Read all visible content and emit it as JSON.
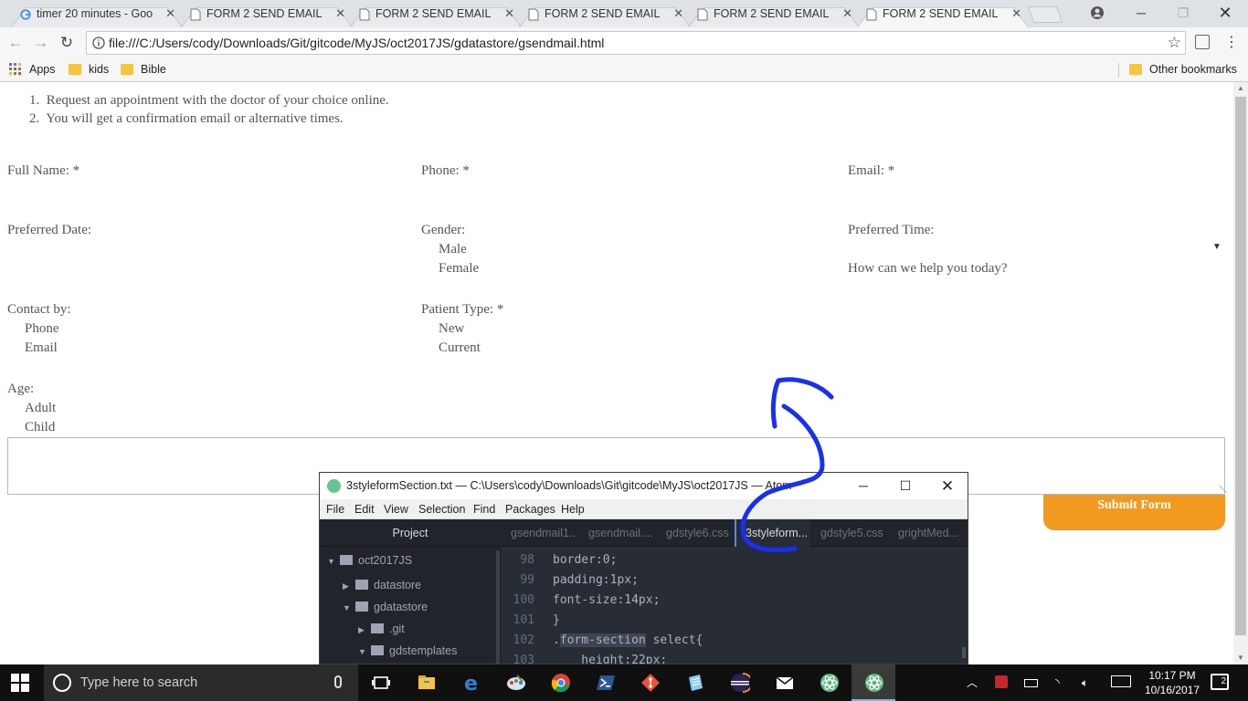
{
  "browser": {
    "tabs": [
      {
        "title": "timer 20 minutes - Goo",
        "icon": "google-icon",
        "active": false
      },
      {
        "title": "FORM 2 SEND EMAIL",
        "icon": "document-icon",
        "active": false
      },
      {
        "title": "FORM 2 SEND EMAIL",
        "icon": "document-icon",
        "active": false
      },
      {
        "title": "FORM 2 SEND EMAIL",
        "icon": "document-icon",
        "active": false
      },
      {
        "title": "FORM 2 SEND EMAIL",
        "icon": "document-icon",
        "active": false
      },
      {
        "title": "FORM 2 SEND EMAIL",
        "icon": "document-icon",
        "active": true
      }
    ],
    "url": "file:///C:/Users/cody/Downloads/Git/gitcode/MyJS/oct2017JS/gdatastore/gsendmail.html",
    "bookmarks": {
      "apps": "Apps",
      "items": [
        "kids",
        "Bible"
      ],
      "other": "Other bookmarks"
    }
  },
  "page": {
    "steps": [
      "1.  Request an appointment with the doctor of your choice online.",
      "2.  You will get a confirmation email or alternative times."
    ],
    "fields": {
      "full_name": "Full Name: *",
      "phone": "Phone: *",
      "email": "Email: *",
      "preferred_date": "Preferred Date:",
      "gender": "Gender:",
      "gender_options": [
        "Male",
        "Female"
      ],
      "preferred_time": "Preferred Time:",
      "help": "How can we help you today?",
      "contact_by": "Contact by:",
      "contact_options": [
        "Phone",
        "Email"
      ],
      "patient_type": "Patient Type: *",
      "patient_options": [
        "New",
        "Current"
      ],
      "age": "Age:",
      "age_options": [
        "Adult",
        "Child"
      ]
    },
    "submit_label": "Submit Form",
    "accent_color": "#f29a1f"
  },
  "atom": {
    "title": "3styleformSection.txt — C:\\Users\\cody\\Downloads\\Git\\gitcode\\MyJS\\oct2017JS — Atom",
    "menu": [
      "File",
      "Edit",
      "View",
      "Selection",
      "Find",
      "Packages",
      "Help"
    ],
    "project_label": "Project",
    "tree": [
      "oct2017JS",
      "datastore",
      "gdatastore",
      ".git",
      "gdstemplates"
    ],
    "tabs": [
      "gsendmail1..",
      "gsendmail....",
      "gdstyle6.css",
      "3styleform...",
      "gdstyle5.css",
      "grightMed..."
    ],
    "lines": [
      {
        "num": "98",
        "code": "border:0;"
      },
      {
        "num": "99",
        "code": "padding:1px;"
      },
      {
        "num": "100",
        "code": "font-size:14px;"
      },
      {
        "num": "101",
        "code": "}"
      },
      {
        "num": "102",
        "pre": ".",
        "hl": "form-section",
        "post": " select{"
      },
      {
        "num": "103",
        "code": "    height:22px;"
      }
    ]
  },
  "taskbar": {
    "search_placeholder": "Type here to search",
    "time": "10:17 PM",
    "date": "10/16/2017",
    "notifications": "2",
    "apps": [
      "file-explorer-icon",
      "edge-icon",
      "paint-icon",
      "chrome-icon",
      "powershell-icon",
      "git-icon",
      "notepad-icon",
      "eclipse-icon",
      "mail-icon",
      "atom-icon",
      "atom-icon"
    ]
  }
}
